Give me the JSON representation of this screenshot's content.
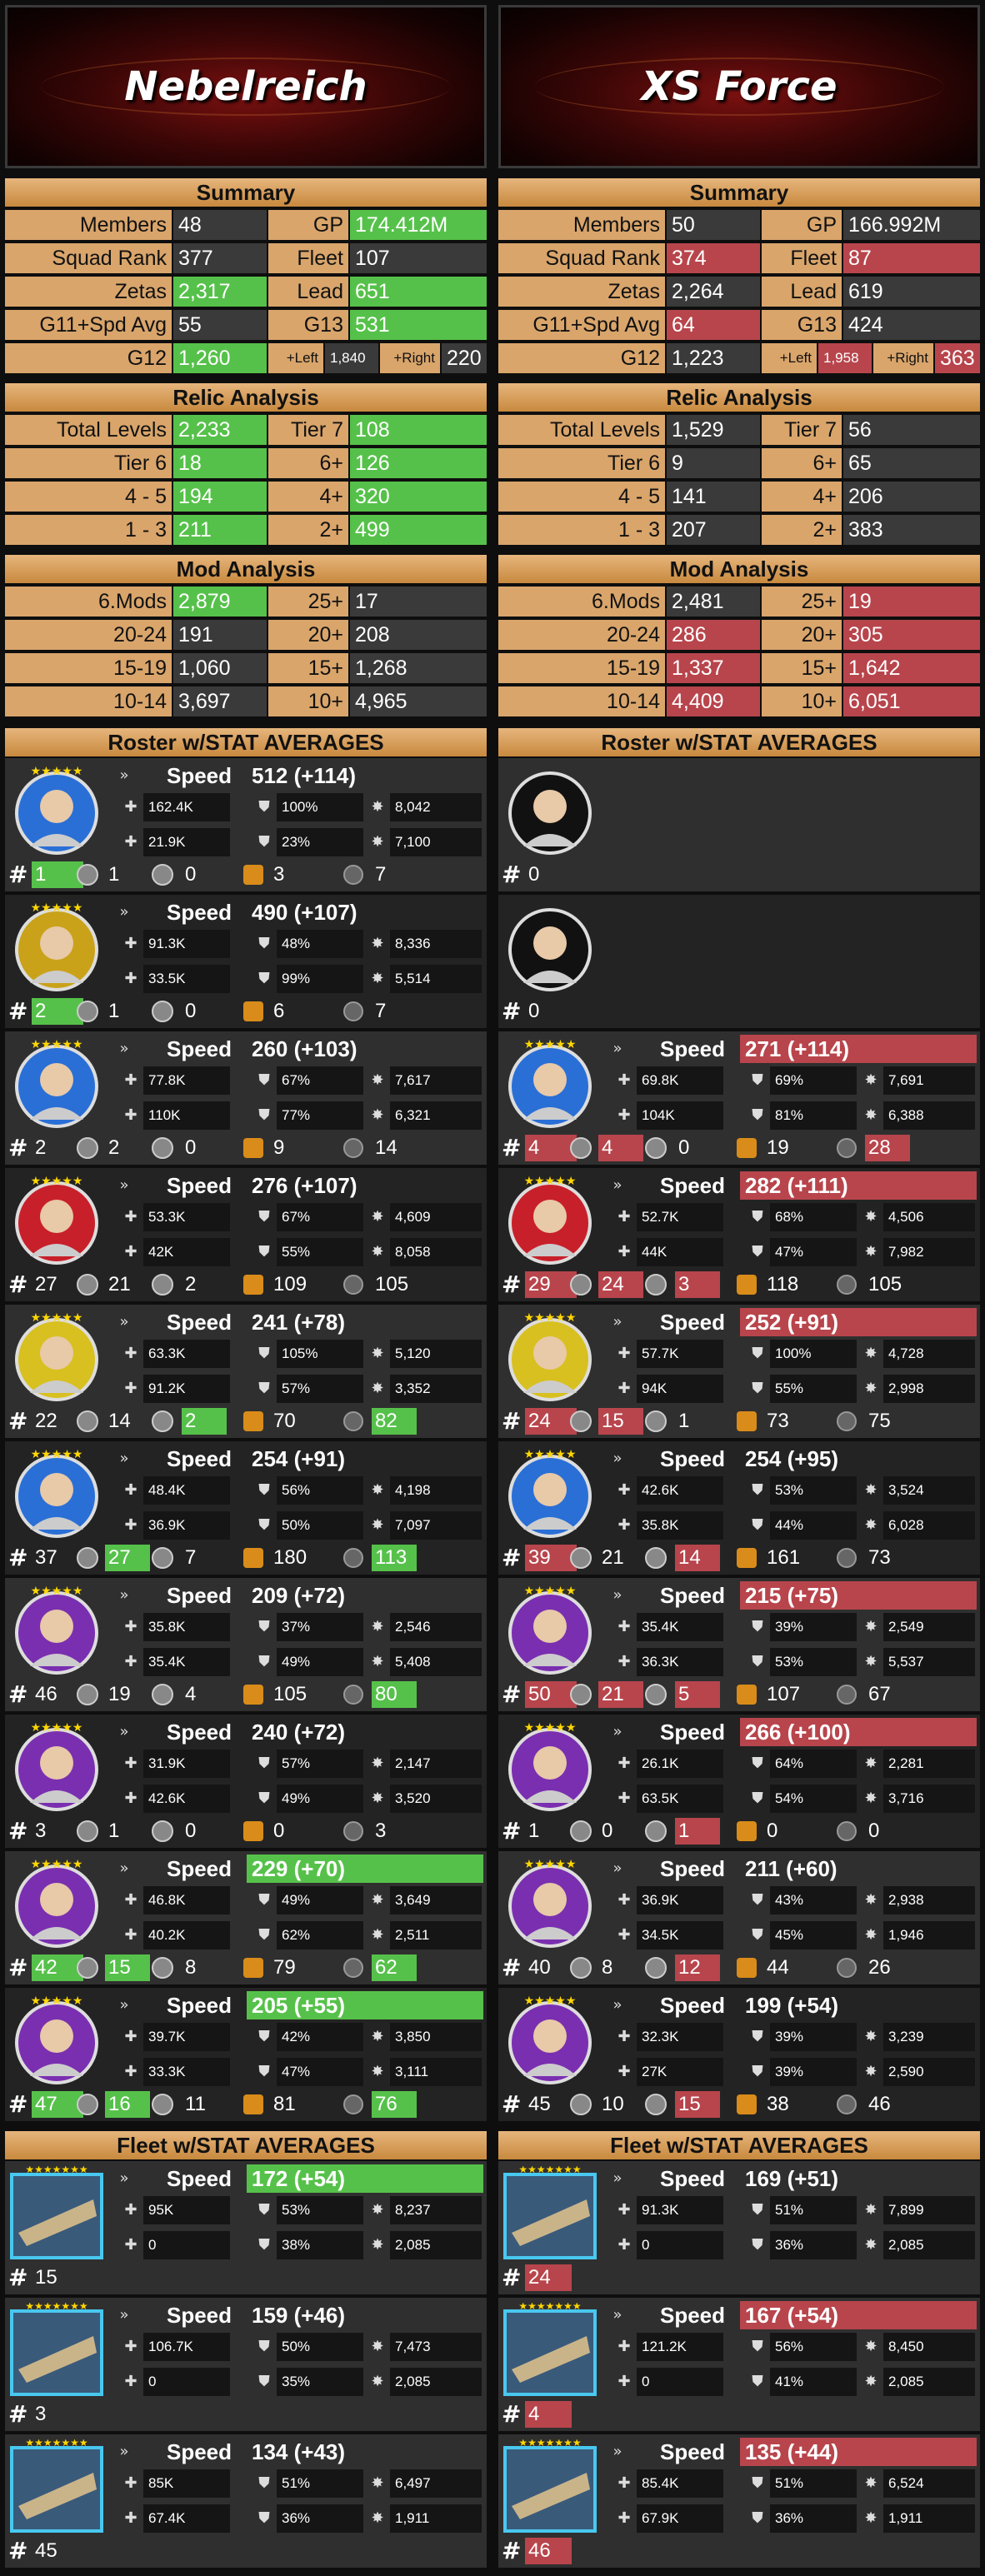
{
  "left": {
    "team": "Nebelreich"
  },
  "right": {
    "team": "XS Force"
  },
  "headers": {
    "summary": "Summary",
    "relic": "Relic Analysis",
    "mod": "Mod Analysis",
    "roster": "Roster w/STAT AVERAGES",
    "fleet": "Fleet w/STAT AVERAGES"
  },
  "summary": {
    "labels": [
      "Members",
      "GP",
      "Squad Rank",
      "Fleet",
      "Zetas",
      "Lead",
      "G11+Spd Avg",
      "G13",
      "G12"
    ],
    "left": {
      "members": "48",
      "gp": "174.412M",
      "squad_rank": "377",
      "fleet": "107",
      "zetas": "2,317",
      "lead": "651",
      "g11": "55",
      "g13": "531",
      "g12": "1,260",
      "left_lbl": "+Left",
      "left_val": "1,840",
      "right_lbl": "+Right",
      "right_val": "220"
    },
    "right": {
      "members": "50",
      "gp": "166.992M",
      "squad_rank": "374",
      "fleet": "87",
      "zetas": "2,264",
      "lead": "619",
      "g11": "64",
      "g13": "424",
      "g12": "1,223",
      "left_lbl": "+Left",
      "left_val": "1,958",
      "right_lbl": "+Right",
      "right_val": "363"
    }
  },
  "relic": {
    "labels": [
      "Total Levels",
      "Tier 7",
      "Tier 6",
      "6+",
      "4 - 5",
      "4+",
      "1 - 3",
      "2+"
    ],
    "left": [
      "2,233",
      "108",
      "18",
      "126",
      "194",
      "320",
      "211",
      "499"
    ],
    "right": [
      "1,529",
      "56",
      "9",
      "65",
      "141",
      "206",
      "207",
      "383"
    ]
  },
  "mods": {
    "labels": [
      "6.Mods",
      "25+",
      "20-24",
      "20+",
      "15-19",
      "15+",
      "10-14",
      "10+"
    ],
    "left": [
      "2,879",
      "17",
      "191",
      "208",
      "1,060",
      "1,268",
      "3,697",
      "4,965"
    ],
    "right": [
      "2,481",
      "19",
      "286",
      "305",
      "1,337",
      "1,642",
      "4,409",
      "6,051"
    ]
  },
  "speed_label": "Speed",
  "hash": "#",
  "roster_left": [
    {
      "speed": "512 (+114)",
      "a": "162.4K",
      "b": "100%",
      "c": "8,042",
      "d": "21.9K",
      "e": "23%",
      "f": "7,100",
      "n": [
        "1",
        "1",
        "0",
        "3",
        "7"
      ]
    },
    {
      "speed": "490 (+107)",
      "a": "91.3K",
      "b": "48%",
      "c": "8,336",
      "d": "33.5K",
      "e": "99%",
      "f": "5,514",
      "n": [
        "2",
        "1",
        "0",
        "6",
        "7"
      ]
    },
    {
      "speed": "260 (+103)",
      "a": "77.8K",
      "b": "67%",
      "c": "7,617",
      "d": "110K",
      "e": "77%",
      "f": "6,321",
      "n": [
        "2",
        "2",
        "0",
        "9",
        "14"
      ]
    },
    {
      "speed": "276 (+107)",
      "a": "53.3K",
      "b": "67%",
      "c": "4,609",
      "d": "42K",
      "e": "55%",
      "f": "8,058",
      "n": [
        "27",
        "21",
        "2",
        "109",
        "105"
      ]
    },
    {
      "speed": "241 (+78)",
      "a": "63.3K",
      "b": "105%",
      "c": "5,120",
      "d": "91.2K",
      "e": "57%",
      "f": "3,352",
      "n": [
        "22",
        "14",
        "2",
        "70",
        "82"
      ]
    },
    {
      "speed": "254 (+91)",
      "a": "48.4K",
      "b": "56%",
      "c": "4,198",
      "d": "36.9K",
      "e": "50%",
      "f": "7,097",
      "n": [
        "37",
        "27",
        "7",
        "180",
        "113"
      ]
    },
    {
      "speed": "209 (+72)",
      "a": "35.8K",
      "b": "37%",
      "c": "2,546",
      "d": "35.4K",
      "e": "49%",
      "f": "5,408",
      "n": [
        "46",
        "19",
        "4",
        "105",
        "80"
      ]
    },
    {
      "speed": "240 (+72)",
      "a": "31.9K",
      "b": "57%",
      "c": "2,147",
      "d": "42.6K",
      "e": "49%",
      "f": "3,520",
      "n": [
        "3",
        "1",
        "0",
        "0",
        "3"
      ]
    },
    {
      "speed": "229 (+70)",
      "a": "46.8K",
      "b": "49%",
      "c": "3,649",
      "d": "40.2K",
      "e": "62%",
      "f": "2,511",
      "n": [
        "42",
        "15",
        "8",
        "79",
        "62"
      ]
    },
    {
      "speed": "205 (+55)",
      "a": "39.7K",
      "b": "42%",
      "c": "3,850",
      "d": "33.3K",
      "e": "47%",
      "f": "3,111",
      "n": [
        "47",
        "16",
        "11",
        "81",
        "76"
      ]
    }
  ],
  "roster_right": [
    {
      "empty": true,
      "n0": "0"
    },
    {
      "empty": true,
      "n0": "0"
    },
    {
      "speed": "271 (+114)",
      "a": "69.8K",
      "b": "69%",
      "c": "7,691",
      "d": "104K",
      "e": "81%",
      "f": "6,388",
      "n": [
        "4",
        "4",
        "0",
        "19",
        "28"
      ]
    },
    {
      "speed": "282 (+111)",
      "a": "52.7K",
      "b": "68%",
      "c": "4,506",
      "d": "44K",
      "e": "47%",
      "f": "7,982",
      "n": [
        "29",
        "24",
        "3",
        "118",
        "105"
      ]
    },
    {
      "speed": "252 (+91)",
      "a": "57.7K",
      "b": "100%",
      "c": "4,728",
      "d": "94K",
      "e": "55%",
      "f": "2,998",
      "n": [
        "24",
        "15",
        "1",
        "73",
        "75"
      ]
    },
    {
      "speed": "254 (+95)",
      "a": "42.6K",
      "b": "53%",
      "c": "3,524",
      "d": "35.8K",
      "e": "44%",
      "f": "6,028",
      "n": [
        "39",
        "21",
        "14",
        "161",
        "73"
      ]
    },
    {
      "speed": "215 (+75)",
      "a": "35.4K",
      "b": "39%",
      "c": "2,549",
      "d": "36.3K",
      "e": "53%",
      "f": "5,537",
      "n": [
        "50",
        "21",
        "5",
        "107",
        "67"
      ]
    },
    {
      "speed": "266 (+100)",
      "a": "26.1K",
      "b": "64%",
      "c": "2,281",
      "d": "63.5K",
      "e": "54%",
      "f": "3,716",
      "n": [
        "1",
        "0",
        "1",
        "0",
        "0"
      ]
    },
    {
      "speed": "211 (+60)",
      "a": "36.9K",
      "b": "43%",
      "c": "2,938",
      "d": "34.5K",
      "e": "45%",
      "f": "1,946",
      "n": [
        "40",
        "8",
        "12",
        "44",
        "26"
      ]
    },
    {
      "speed": "199 (+54)",
      "a": "32.3K",
      "b": "39%",
      "c": "3,239",
      "d": "27K",
      "e": "39%",
      "f": "2,590",
      "n": [
        "45",
        "10",
        "15",
        "38",
        "46"
      ]
    }
  ],
  "fleet_left": [
    {
      "speed": "172 (+54)",
      "a": "95K",
      "b": "53%",
      "c": "8,237",
      "d": "0",
      "e": "38%",
      "f": "2,085",
      "n": "15"
    },
    {
      "speed": "159 (+46)",
      "a": "106.7K",
      "b": "50%",
      "c": "7,473",
      "d": "0",
      "e": "35%",
      "f": "2,085",
      "n": "3"
    },
    {
      "speed": "134 (+43)",
      "a": "85K",
      "b": "51%",
      "c": "6,497",
      "d": "67.4K",
      "e": "36%",
      "f": "1,911",
      "n": "45"
    }
  ],
  "fleet_right": [
    {
      "speed": "169 (+51)",
      "a": "91.3K",
      "b": "51%",
      "c": "7,899",
      "d": "0",
      "e": "36%",
      "f": "2,085",
      "n": "24"
    },
    {
      "speed": "167 (+54)",
      "a": "121.2K",
      "b": "56%",
      "c": "8,450",
      "d": "0",
      "e": "41%",
      "f": "2,085",
      "n": "4"
    },
    {
      "speed": "135 (+44)",
      "a": "85.4K",
      "b": "51%",
      "c": "6,524",
      "d": "67.9K",
      "e": "36%",
      "f": "1,911",
      "n": "46"
    }
  ]
}
